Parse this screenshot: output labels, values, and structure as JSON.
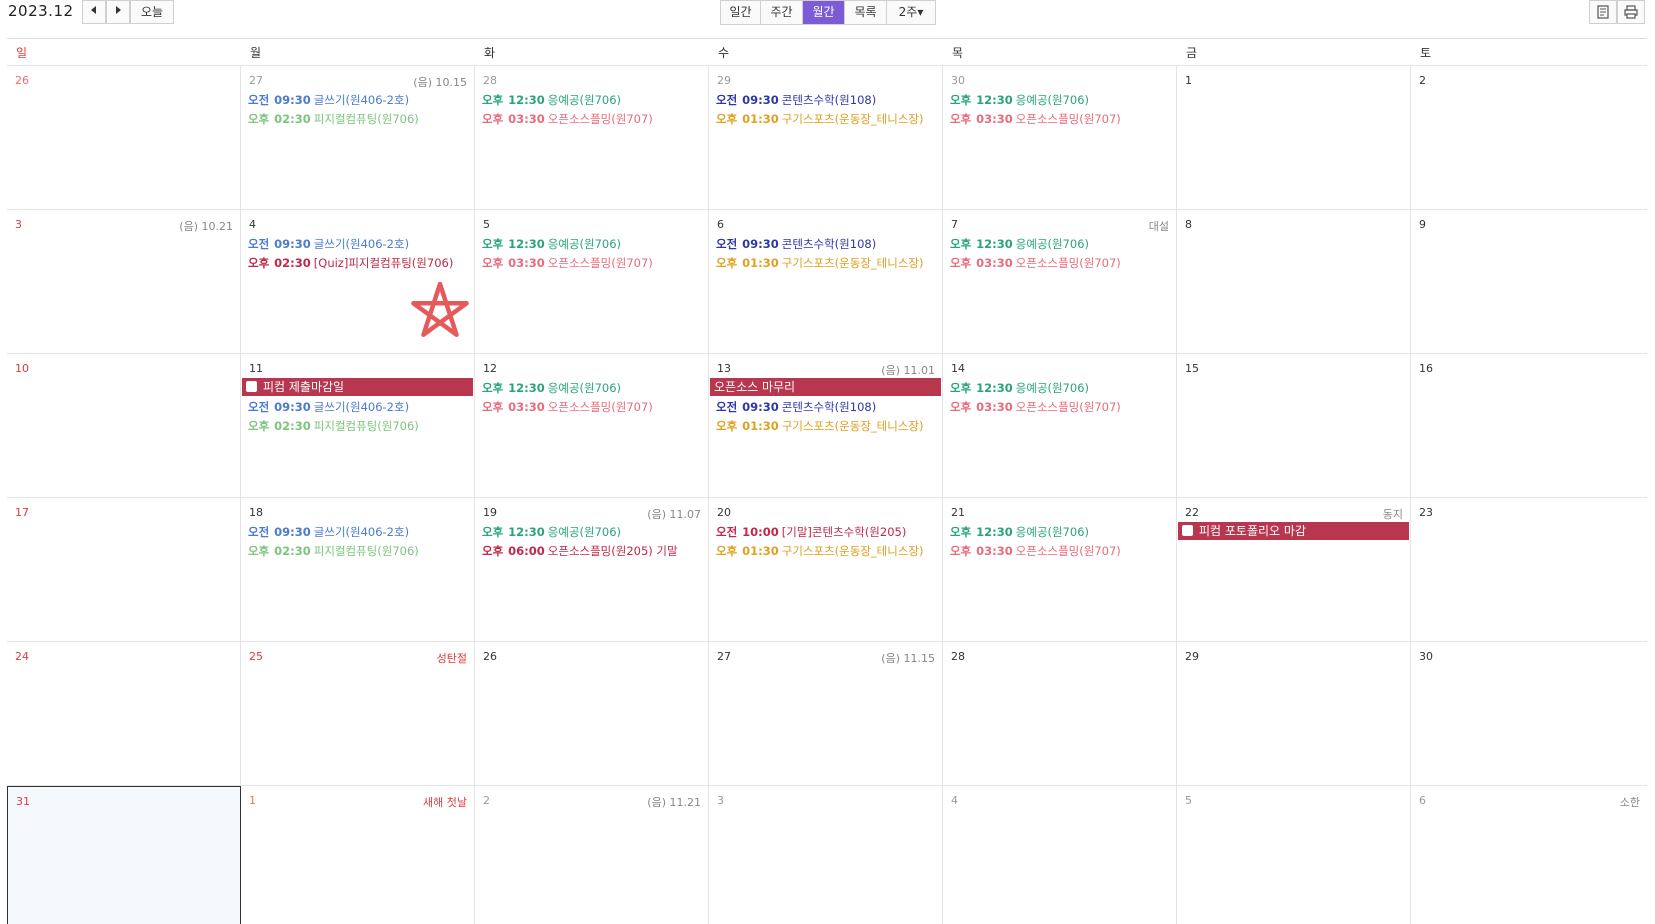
{
  "toolbar": {
    "title": "2023.12",
    "prev_icon": "caret-left",
    "next_icon": "caret-right",
    "today_label": "오늘",
    "views": [
      {
        "label": "일간",
        "active": false
      },
      {
        "label": "주간",
        "active": false
      },
      {
        "label": "월간",
        "active": true
      },
      {
        "label": "목록",
        "active": false
      },
      {
        "label": "2주▾",
        "active": false
      }
    ],
    "right_icons": [
      "calendar-print-icon",
      "printer-icon"
    ]
  },
  "colors": {
    "accent": "#7b5cd6",
    "event_blue": "#4a7bd0",
    "event_lightgreen": "#7cc57c",
    "event_teal": "#2aa57a",
    "event_pink": "#e86b7e",
    "event_navy": "#2e37a8",
    "event_orange": "#e0a020",
    "event_crimson": "#c0284a",
    "bar_bg": "#b8374e",
    "sunday": "#e03a3a",
    "star": "#e55a5a"
  },
  "weekdays": [
    "일",
    "월",
    "화",
    "수",
    "목",
    "금",
    "토"
  ],
  "weeks": [
    [
      {
        "day": "26",
        "other": true,
        "sun": true
      },
      {
        "day": "27",
        "other": true,
        "label": "(음) 10.15",
        "events": [
          {
            "ampm": "오전",
            "time": "09:30",
            "title": "글쓰기(원406-2호)",
            "color": "event_blue"
          },
          {
            "ampm": "오후",
            "time": "02:30",
            "title": "피지컬컴퓨팅(원706)",
            "color": "event_lightgreen"
          }
        ]
      },
      {
        "day": "28",
        "other": true,
        "events": [
          {
            "ampm": "오후",
            "time": "12:30",
            "title": "응예공(원706)",
            "color": "event_teal"
          },
          {
            "ampm": "오후",
            "time": "03:30",
            "title": "오픈소스플밍(원707)",
            "color": "event_pink"
          }
        ]
      },
      {
        "day": "29",
        "other": true,
        "events": [
          {
            "ampm": "오전",
            "time": "09:30",
            "title": "콘텐츠수학(원108)",
            "color": "event_navy"
          },
          {
            "ampm": "오후",
            "time": "01:30",
            "title": "구기스포츠(운동장_테니스장)",
            "color": "event_orange"
          }
        ]
      },
      {
        "day": "30",
        "other": true,
        "events": [
          {
            "ampm": "오후",
            "time": "12:30",
            "title": "응예공(원706)",
            "color": "event_teal"
          },
          {
            "ampm": "오후",
            "time": "03:30",
            "title": "오픈소스플밍(원707)",
            "color": "event_pink"
          }
        ]
      },
      {
        "day": "1"
      },
      {
        "day": "2"
      }
    ],
    [
      {
        "day": "3",
        "sun": true,
        "label": "(음) 10.21"
      },
      {
        "day": "4",
        "events": [
          {
            "ampm": "오전",
            "time": "09:30",
            "title": "글쓰기(원406-2호)",
            "color": "event_blue"
          },
          {
            "ampm": "오후",
            "time": "02:30",
            "title": "[Quiz]피지컬컴퓨팅(원706)",
            "color": "event_crimson"
          }
        ],
        "star": true
      },
      {
        "day": "5",
        "events": [
          {
            "ampm": "오후",
            "time": "12:30",
            "title": "응예공(원706)",
            "color": "event_teal"
          },
          {
            "ampm": "오후",
            "time": "03:30",
            "title": "오픈소스플밍(원707)",
            "color": "event_pink"
          }
        ]
      },
      {
        "day": "6",
        "events": [
          {
            "ampm": "오전",
            "time": "09:30",
            "title": "콘텐츠수학(원108)",
            "color": "event_navy"
          },
          {
            "ampm": "오후",
            "time": "01:30",
            "title": "구기스포츠(운동장_테니스장)",
            "color": "event_orange"
          }
        ]
      },
      {
        "day": "7",
        "label": "대설",
        "events": [
          {
            "ampm": "오후",
            "time": "12:30",
            "title": "응예공(원706)",
            "color": "event_teal"
          },
          {
            "ampm": "오후",
            "time": "03:30",
            "title": "오픈소스플밍(원707)",
            "color": "event_pink"
          }
        ]
      },
      {
        "day": "8"
      },
      {
        "day": "9"
      }
    ],
    [
      {
        "day": "10",
        "sun": true
      },
      {
        "day": "11",
        "bar": {
          "title": "피컴 제출마감일",
          "check": true
        },
        "events": [
          {
            "ampm": "오전",
            "time": "09:30",
            "title": "글쓰기(원406-2호)",
            "color": "event_blue"
          },
          {
            "ampm": "오후",
            "time": "02:30",
            "title": "피지컬컴퓨팅(원706)",
            "color": "event_lightgreen"
          }
        ]
      },
      {
        "day": "12",
        "events": [
          {
            "ampm": "오후",
            "time": "12:30",
            "title": "응예공(원706)",
            "color": "event_teal"
          },
          {
            "ampm": "오후",
            "time": "03:30",
            "title": "오픈소스플밍(원707)",
            "color": "event_pink"
          }
        ]
      },
      {
        "day": "13",
        "label": "(음) 11.01",
        "bar": {
          "title": "오픈소스 마무리",
          "check": false
        },
        "events": [
          {
            "ampm": "오전",
            "time": "09:30",
            "title": "콘텐츠수학(원108)",
            "color": "event_navy"
          },
          {
            "ampm": "오후",
            "time": "01:30",
            "title": "구기스포츠(운동장_테니스장)",
            "color": "event_orange"
          }
        ]
      },
      {
        "day": "14",
        "events": [
          {
            "ampm": "오후",
            "time": "12:30",
            "title": "응예공(원706)",
            "color": "event_teal"
          },
          {
            "ampm": "오후",
            "time": "03:30",
            "title": "오픈소스플밍(원707)",
            "color": "event_pink"
          }
        ]
      },
      {
        "day": "15"
      },
      {
        "day": "16"
      }
    ],
    [
      {
        "day": "17",
        "sun": true
      },
      {
        "day": "18",
        "events": [
          {
            "ampm": "오전",
            "time": "09:30",
            "title": "글쓰기(원406-2호)",
            "color": "event_blue"
          },
          {
            "ampm": "오후",
            "time": "02:30",
            "title": "피지컬컴퓨팅(원706)",
            "color": "event_lightgreen"
          }
        ]
      },
      {
        "day": "19",
        "label": "(음) 11.07",
        "events": [
          {
            "ampm": "오후",
            "time": "12:30",
            "title": "응예공(원706)",
            "color": "event_teal"
          },
          {
            "ampm": "오후",
            "time": "06:00",
            "title": "오픈소스플밍(원205) 기말",
            "color": "event_crimson"
          }
        ]
      },
      {
        "day": "20",
        "events": [
          {
            "ampm": "오전",
            "time": "10:00",
            "title": "[기말]콘텐츠수학(원205)",
            "color": "event_crimson"
          },
          {
            "ampm": "오후",
            "time": "01:30",
            "title": "구기스포츠(운동장_테니스장)",
            "color": "event_orange"
          }
        ]
      },
      {
        "day": "21",
        "events": [
          {
            "ampm": "오후",
            "time": "12:30",
            "title": "응예공(원706)",
            "color": "event_teal"
          },
          {
            "ampm": "오후",
            "time": "03:30",
            "title": "오픈소스플밍(원707)",
            "color": "event_pink"
          }
        ]
      },
      {
        "day": "22",
        "label": "동지",
        "bar": {
          "title": "피컴 포토폴리오 마감",
          "check": true
        }
      },
      {
        "day": "23"
      }
    ],
    [
      {
        "day": "24",
        "sun": true
      },
      {
        "day": "25",
        "holiday": true,
        "label": "성탄절",
        "labelHoliday": true
      },
      {
        "day": "26"
      },
      {
        "day": "27",
        "label": "(음) 11.15"
      },
      {
        "day": "28"
      },
      {
        "day": "29"
      },
      {
        "day": "30"
      }
    ],
    [
      {
        "day": "31",
        "sun": true,
        "today": true
      },
      {
        "day": "1",
        "other": true,
        "holiday": true,
        "label": "새해 첫날",
        "labelHoliday": true
      },
      {
        "day": "2",
        "other": true,
        "label": "(음) 11.21"
      },
      {
        "day": "3",
        "other": true
      },
      {
        "day": "4",
        "other": true
      },
      {
        "day": "5",
        "other": true
      },
      {
        "day": "6",
        "other": true,
        "label": "소한"
      }
    ]
  ]
}
